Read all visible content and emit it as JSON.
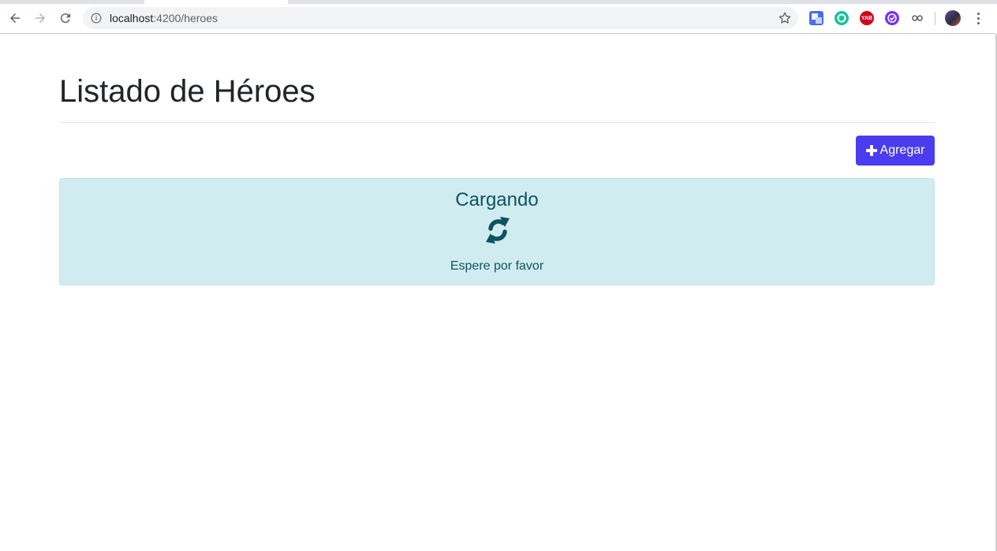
{
  "browser": {
    "url_host": "localhost",
    "url_path": ":4200/heroes",
    "extensions": [
      {
        "name": "google-translate-icon",
        "color": "#4a6ee0"
      },
      {
        "name": "grammarly-icon",
        "color": "#15c39a"
      },
      {
        "name": "yab-icon",
        "label": "YAB",
        "color": "#d0021b"
      },
      {
        "name": "checkmark-extension-icon",
        "color": "#7b2ff7"
      },
      {
        "name": "infinity-extension-icon",
        "color": "#5f6368"
      }
    ]
  },
  "page": {
    "title": "Listado de Héroes",
    "add_button_label": "Agregar"
  },
  "alert": {
    "title": "Cargando",
    "message": "Espere por favor",
    "icon": "refresh-icon"
  },
  "colors": {
    "primary": "#4b3cf0",
    "alert_bg": "#d1ecf1",
    "alert_text": "#0c5460"
  }
}
